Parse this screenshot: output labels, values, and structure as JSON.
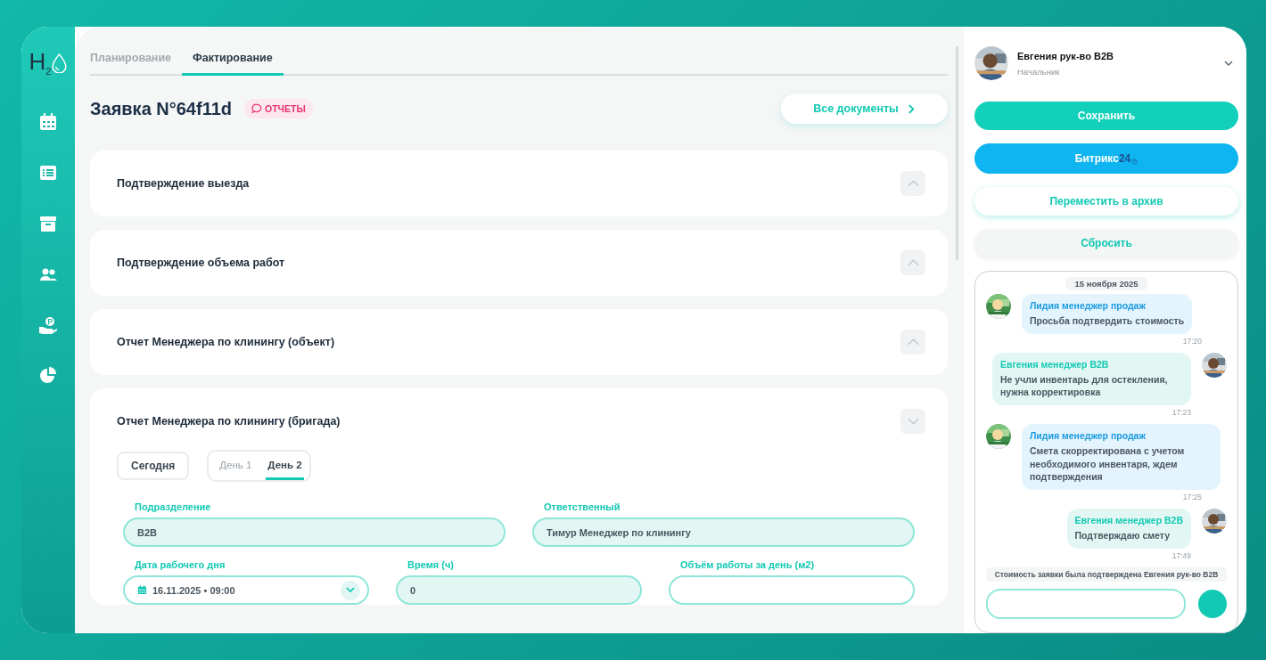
{
  "logo": "H$_{2}$",
  "tabs": [
    {
      "label": "Планирование",
      "selected": false
    },
    {
      "label": "Фактирование",
      "selected": true
    }
  ],
  "title": "Заявка N°64f11d",
  "reports_badge": "ОТЧЕТЫ",
  "documents_button": "Все документы",
  "sections": [
    {
      "title": "Подтверждение выезда",
      "expanded": false
    },
    {
      "title": "Подтверждение объема работ",
      "expanded": false
    },
    {
      "title": "Отчет Менеджера по клинингу (объект)",
      "expanded": false
    },
    {
      "title": "Отчет Менеджера по клинингу (бригада)",
      "expanded": true
    }
  ],
  "today_button": "Сегодня",
  "day_tabs": [
    {
      "label": "День 1",
      "selected": false
    },
    {
      "label": "День 2",
      "selected": true
    }
  ],
  "field_rows": [
    [
      {
        "kind": "text",
        "label": "Подразделение",
        "value": "B2B"
      },
      {
        "kind": "text",
        "label": "Ответственный",
        "value": "Тимур Менеджер по клинингу"
      }
    ],
    [
      {
        "kind": "date",
        "label": "Дата рабочего дня",
        "value": "16.11.2025 • 09:00"
      },
      {
        "kind": "text",
        "label": "Время (ч)",
        "value": "0"
      },
      {
        "kind": "text",
        "label": "Объём работы за день (м2)"
      }
    ]
  ],
  "user": {
    "name": "Евгения рук-во B2B",
    "role": "Начальник"
  },
  "actions": [
    {
      "kind": "primary",
      "label": "Сохранить"
    },
    {
      "kind": "bitrix",
      "label": "Битрикс",
      "suffix": "24"
    },
    {
      "kind": "outline",
      "label": "Переместить в архив"
    },
    {
      "kind": "muted",
      "label": "Сбросить"
    }
  ],
  "chat": {
    "date": "15 ноября 2025",
    "messages": [
      {
        "kind": "incoming",
        "author": "Лидия менеджер продаж",
        "text": "Просьба подтвердить стоимость",
        "time": "17:20"
      },
      {
        "kind": "outgoing",
        "author": "Евгения менеджер B2B",
        "text": "Не учли инвентарь для остекления, нужна корректировка",
        "time": "17:23"
      },
      {
        "kind": "incoming",
        "author": "Лидия менеджер продаж",
        "text": "Смета скорректирована с учетом необходимого инвентаря, ждем подтверждения",
        "time": "17:25"
      },
      {
        "kind": "outgoing",
        "author": "Евгения менеджер B2B",
        "text": "Подтверждаю смету",
        "time": "17:49"
      }
    ],
    "system_note": "Стоимость заявки была подтверждена Евгения рук-во B2B"
  }
}
